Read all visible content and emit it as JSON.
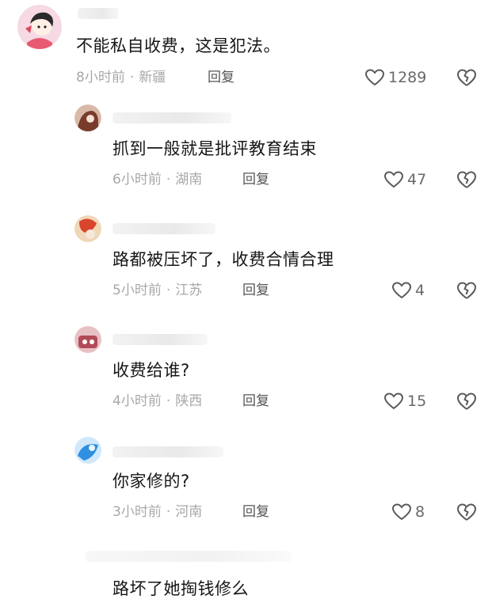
{
  "comments": [
    {
      "text": "不能私自收费，这是犯法。",
      "time": "8小时前",
      "location": "新疆",
      "reply_label": "回复",
      "likes": "1289",
      "avatar_colors": [
        "#f6d9e3",
        "#d94a62"
      ]
    },
    {
      "text": "抓到一般就是批评教育结束",
      "time": "6小时前",
      "location": "湖南",
      "reply_label": "回复",
      "likes": "47",
      "avatar_colors": [
        "#d9b9a8",
        "#7a3b2c"
      ]
    },
    {
      "text": "路都被压坏了，收费合情合理",
      "time": "5小时前",
      "location": "江苏",
      "reply_label": "回复",
      "likes": "4",
      "avatar_colors": [
        "#f0d7b8",
        "#d9452c"
      ]
    },
    {
      "text": "收费给谁?",
      "time": "4小时前",
      "location": "陕西",
      "reply_label": "回复",
      "likes": "15",
      "avatar_colors": [
        "#e7c1c4",
        "#b34a57"
      ]
    },
    {
      "text": "你家修的?",
      "time": "3小时前",
      "location": "河南",
      "reply_label": "回复",
      "likes": "8",
      "avatar_colors": [
        "#cfe8fb",
        "#2f8fe0"
      ]
    },
    {
      "text": "路坏了她掏钱修么"
    }
  ],
  "icons": {
    "like": "heart-outline-icon",
    "dislike": "broken-heart-icon"
  }
}
